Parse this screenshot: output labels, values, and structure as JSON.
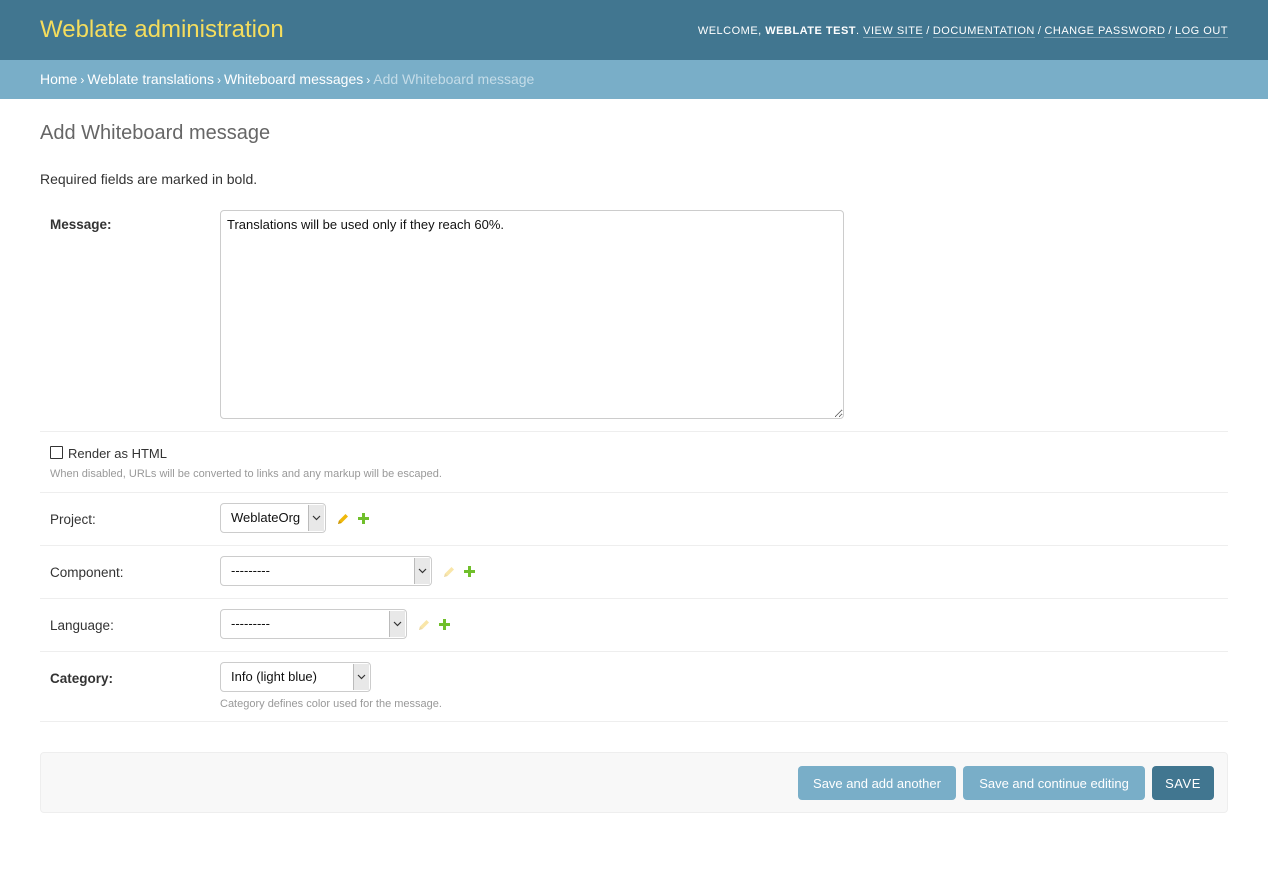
{
  "header": {
    "branding": "Weblate administration",
    "welcome": "Welcome,",
    "username": "Weblate Test",
    "links": [
      "View site",
      "Documentation",
      "Change password",
      "Log out"
    ]
  },
  "breadcrumbs": {
    "home": "Home",
    "app": "Weblate translations",
    "model": "Whiteboard messages",
    "current": "Add Whiteboard message"
  },
  "page": {
    "title": "Add Whiteboard message",
    "required_note": "Required fields are marked in bold."
  },
  "form": {
    "message": {
      "label": "Message:",
      "value": "Translations will be used only if they reach 60%."
    },
    "render_html": {
      "label": "Render as HTML",
      "checked": false,
      "help": "When disabled, URLs will be converted to links and any markup will be escaped."
    },
    "project": {
      "label": "Project:",
      "value": "WeblateOrg"
    },
    "component": {
      "label": "Component:",
      "value": "---------"
    },
    "language": {
      "label": "Language:",
      "value": "---------"
    },
    "category": {
      "label": "Category:",
      "value": "Info (light blue)",
      "help": "Category defines color used for the message."
    }
  },
  "actions": {
    "save_add_another": "Save and add another",
    "save_continue": "Save and continue editing",
    "save": "SAVE"
  },
  "colors": {
    "header_bg": "#417690",
    "branding": "#f5dd5d",
    "breadcrumbs_bg": "#79aec8",
    "change_icon": "#efb80b",
    "add_icon": "#70bf2b"
  },
  "icons": {
    "change": "pencil-icon",
    "add": "plus-icon",
    "dropdown": "chevron-down-icon"
  }
}
